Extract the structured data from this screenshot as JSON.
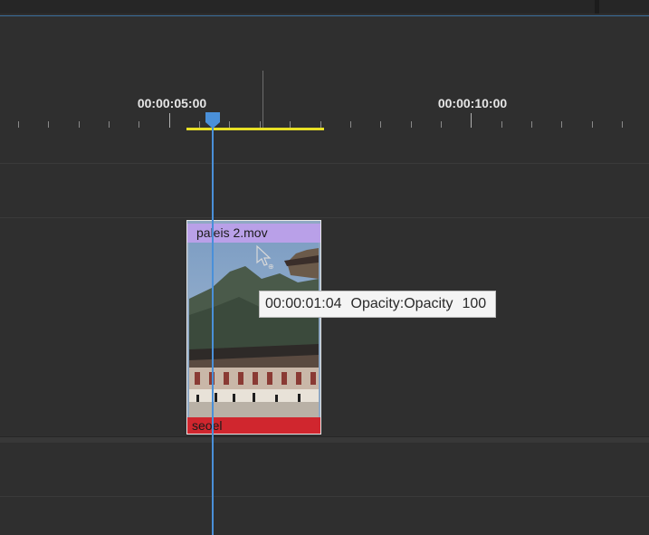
{
  "timeline": {
    "timecode_labels": [
      "00:00:05:00",
      "00:00:10:00"
    ]
  },
  "clip": {
    "name": "paleis 2.mov",
    "effect_label": "seoel",
    "header_color": "#b9a0e8",
    "effect_color": "#d0262e"
  },
  "tooltip": {
    "timecode": "00:00:01:04",
    "property": "Opacity:Opacity",
    "value": "100"
  },
  "colors": {
    "playhead": "#4a90d9",
    "work_area": "#e8e026"
  },
  "icons": {
    "playhead": "playhead-marker-icon",
    "cursor": "pointer-cursor-icon"
  }
}
